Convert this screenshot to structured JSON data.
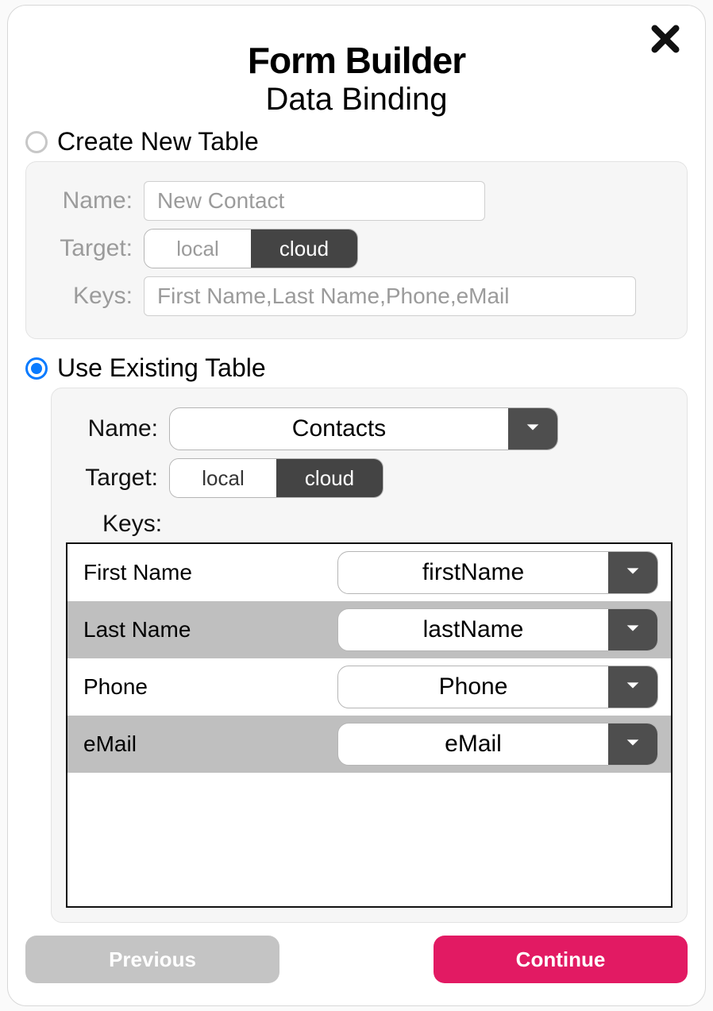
{
  "header": {
    "title": "Form Builder",
    "subtitle": "Data Binding"
  },
  "options": {
    "create_label": "Create New Table",
    "use_label": "Use Existing Table",
    "selected": "use"
  },
  "createPanel": {
    "name_label": "Name:",
    "name_value": "New Contact",
    "target_label": "Target:",
    "target_options": {
      "a": "local",
      "b": "cloud"
    },
    "target_selected": "cloud",
    "keys_label": "Keys:",
    "keys_value": "First Name,Last Name,Phone,eMail"
  },
  "usePanel": {
    "name_label": "Name:",
    "name_value": "Contacts",
    "target_label": "Target:",
    "target_options": {
      "a": "local",
      "b": "cloud"
    },
    "target_selected": "cloud",
    "keys_label": "Keys:",
    "rows": [
      {
        "src": "First Name",
        "dst": "firstName"
      },
      {
        "src": "Last Name",
        "dst": "lastName"
      },
      {
        "src": "Phone",
        "dst": "Phone"
      },
      {
        "src": "eMail",
        "dst": "eMail"
      }
    ]
  },
  "footer": {
    "previous": "Previous",
    "continue": "Continue"
  }
}
